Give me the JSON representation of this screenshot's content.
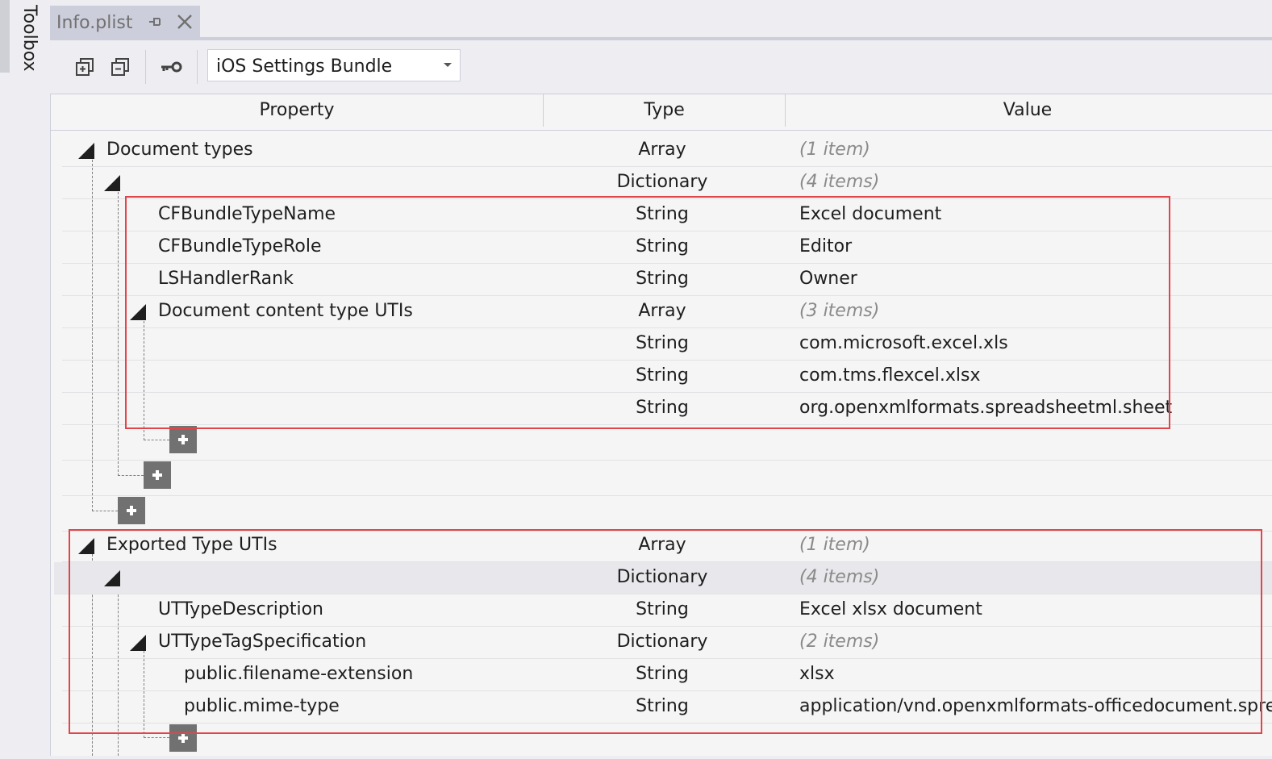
{
  "toolbox": {
    "label": "Toolbox"
  },
  "tab": {
    "title": "Info.plist"
  },
  "toolbar": {
    "scheme_selected": "iOS Settings Bundle"
  },
  "columns": {
    "property": "Property",
    "type": "Type",
    "value": "Value"
  },
  "rows": [
    {
      "property": "Document types",
      "type": "Array",
      "value": "(1 item)"
    },
    {
      "property": "",
      "type": "Dictionary",
      "value": "(4 items)"
    },
    {
      "property": "CFBundleTypeName",
      "type": "String",
      "value": "Excel document"
    },
    {
      "property": "CFBundleTypeRole",
      "type": "String",
      "value": "Editor"
    },
    {
      "property": "LSHandlerRank",
      "type": "String",
      "value": "Owner"
    },
    {
      "property": "Document content type UTIs",
      "type": "Array",
      "value": "(3 items)"
    },
    {
      "property": "",
      "type": "String",
      "value": "com.microsoft.excel.xls"
    },
    {
      "property": "",
      "type": "String",
      "value": "com.tms.flexcel.xlsx"
    },
    {
      "property": "",
      "type": "String",
      "value": "org.openxmlformats.spreadsheetml.sheet"
    },
    {
      "property": "Exported Type UTIs",
      "type": "Array",
      "value": "(1 item)"
    },
    {
      "property": "",
      "type": "Dictionary",
      "value": "(4 items)"
    },
    {
      "property": "UTTypeDescription",
      "type": "String",
      "value": "Excel xlsx document"
    },
    {
      "property": "UTTypeTagSpecification",
      "type": "Dictionary",
      "value": "(2 items)"
    },
    {
      "property": "public.filename-extension",
      "type": "String",
      "value": "xlsx"
    },
    {
      "property": "public.mime-type",
      "type": "String",
      "value": "application/vnd.openxmlformats-officedocument.spre"
    }
  ],
  "colors": {
    "highlight_box": "#e0454a",
    "add_button": "#717171"
  }
}
